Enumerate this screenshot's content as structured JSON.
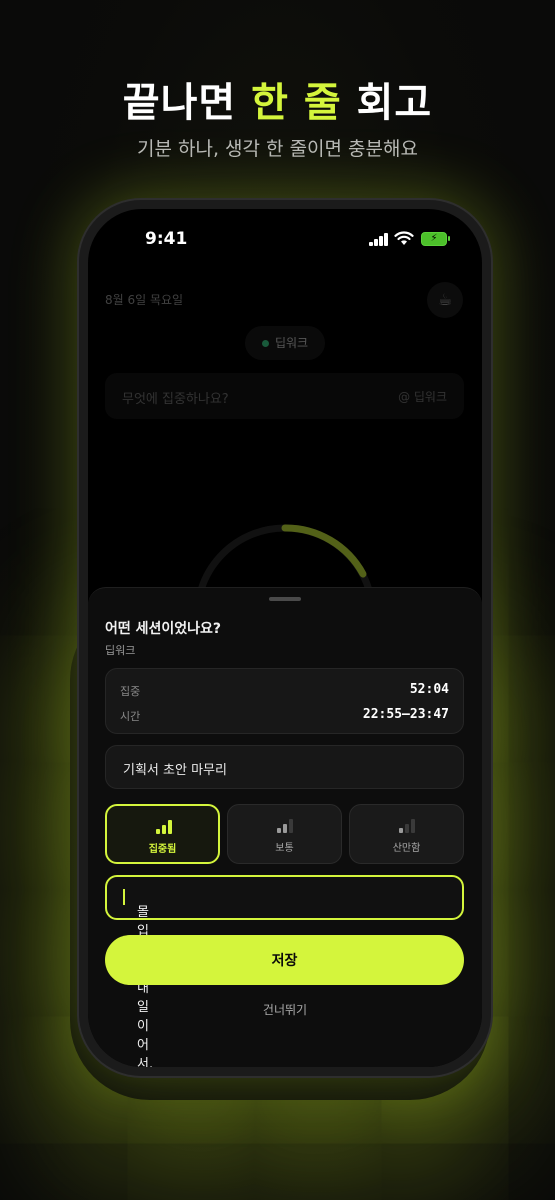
{
  "hero": {
    "title_pre": "끝나면 ",
    "title_accent": "한 줄",
    "title_post": " 회고",
    "subtitle": "기분 하나, 생각 한 줄이면 충분해요"
  },
  "status_bar": {
    "time": "9:41"
  },
  "background_app": {
    "date": "8월 6일 목요일",
    "mode_chip": "딥워크",
    "focus_placeholder": "무엇에 집중하나요?",
    "focus_tag": "@ 딥워크"
  },
  "sheet": {
    "title": "어떤 세션이었나요?",
    "mode": "딥워크",
    "stats": [
      {
        "label": "집중",
        "value": "52:04"
      },
      {
        "label": "시간",
        "value": "22:55–23:47"
      }
    ],
    "task": "기획서 초안 마무리",
    "ratings": [
      {
        "label": "집중됨",
        "level": 3,
        "active": true
      },
      {
        "label": "보통",
        "level": 2,
        "active": false
      },
      {
        "label": "산만함",
        "level": 1,
        "active": false
      }
    ],
    "note_value": "몰입 잘 됨. 내일 이어서.",
    "save_label": "저장",
    "skip_label": "건너뛰기"
  },
  "colors": {
    "accent": "#d4f53c",
    "background": "#0b0b09",
    "mode_dot": "#3dd68c",
    "battery": "#4cc02a"
  },
  "icons": [
    "signal-icon",
    "wifi-icon",
    "battery-icon",
    "coffee-cup-icon",
    "focus-level-bars-icon"
  ]
}
